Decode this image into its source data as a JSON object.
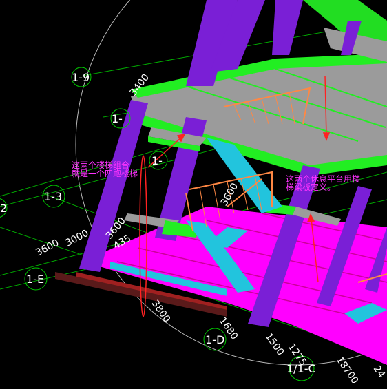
{
  "viewport": {
    "background": "#000000"
  },
  "axis_bubbles": [
    {
      "id": "b19",
      "label": "1-9"
    },
    {
      "id": "b1dash",
      "label": "1-"
    },
    {
      "id": "b1dash2",
      "label": "1-"
    },
    {
      "id": "b13",
      "label": "1-3"
    },
    {
      "id": "b2",
      "label": "2"
    },
    {
      "id": "b1e",
      "label": "1-E"
    },
    {
      "id": "b1d",
      "label": "1-D"
    },
    {
      "id": "b11c",
      "label": "1/1-C"
    }
  ],
  "dimensions": {
    "d3400": "3400",
    "d3600": "3600",
    "d3000": "3000",
    "d3600b": "3600",
    "d435": "435",
    "d3800": "3800",
    "d1680": "1680",
    "d1500": "1500",
    "d1275": "1275",
    "d18700": "18700",
    "d3600c": "3600",
    "d24": "24"
  },
  "annotations": {
    "left_line1": "这两个楼梯组合",
    "left_line2": "就是一个四跑楼梯",
    "right_line1": "这两个休息平台用楼",
    "right_line2": "梯梁板定义。"
  },
  "colors": {
    "column": "#7a1fd6",
    "floor_slab": "#9b9b9b",
    "slab_edge": "#22ee22",
    "stair": "#22c4dd",
    "railing": "#ff8844",
    "ground": "#ff00ff",
    "grid_line": "#00cc00",
    "annotation": "#ff33ff",
    "arrow": "#ff2222"
  }
}
